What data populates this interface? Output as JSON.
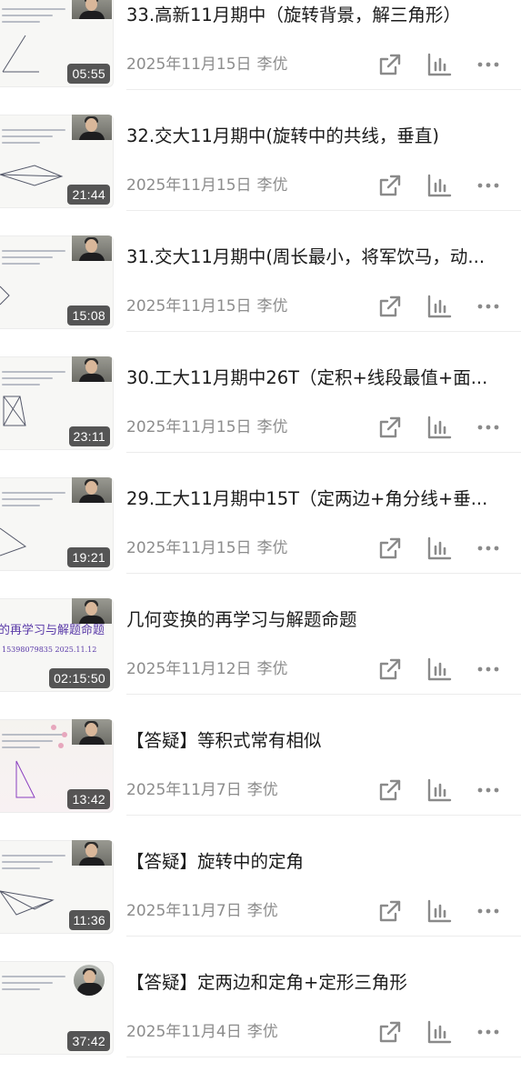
{
  "colors": {
    "title": "#1b1b1b",
    "meta": "#8c8c8c",
    "icon": "#8a8a8a",
    "duration_bg": "#3a3a3a",
    "divider": "#ececec"
  },
  "icons": {
    "share": "share-icon",
    "stats": "bar-chart-icon",
    "more": "more-dots-icon"
  },
  "videos": [
    {
      "title": "33.高新11月期中（旋转背景，解三角形）",
      "date": "2025年11月15日",
      "author": "李优",
      "duration": "05:55"
    },
    {
      "title": "32.交大11月期中(旋转中的共线，垂直)",
      "date": "2025年11月15日",
      "author": "李优",
      "duration": "21:44"
    },
    {
      "title": "31.交大11月期中(周长最小，将军饮马，动...",
      "date": "2025年11月15日",
      "author": "李优",
      "duration": "15:08"
    },
    {
      "title": "30.工大11月期中26T（定积+线段最值+面...",
      "date": "2025年11月15日",
      "author": "李优",
      "duration": "23:11"
    },
    {
      "title": "29.工大11月期中15T（定两边+角分线+垂...",
      "date": "2025年11月15日",
      "author": "李优",
      "duration": "19:21"
    },
    {
      "title": "几何变换的再学习与解题命题",
      "date": "2025年11月12日",
      "author": "李优",
      "duration": "02:15:50",
      "thumb_text": "的再学习与解题命题",
      "thumb_sub": "15398079835     2025.11.12"
    },
    {
      "title": "【答疑】等积式常有相似",
      "date": "2025年11月7日",
      "author": "李优",
      "duration": "13:42"
    },
    {
      "title": "【答疑】旋转中的定角",
      "date": "2025年11月7日",
      "author": "李优",
      "duration": "11:36"
    },
    {
      "title": "【答疑】定两边和定角+定形三角形",
      "date": "2025年11月4日",
      "author": "李优",
      "duration": "37:42"
    }
  ]
}
